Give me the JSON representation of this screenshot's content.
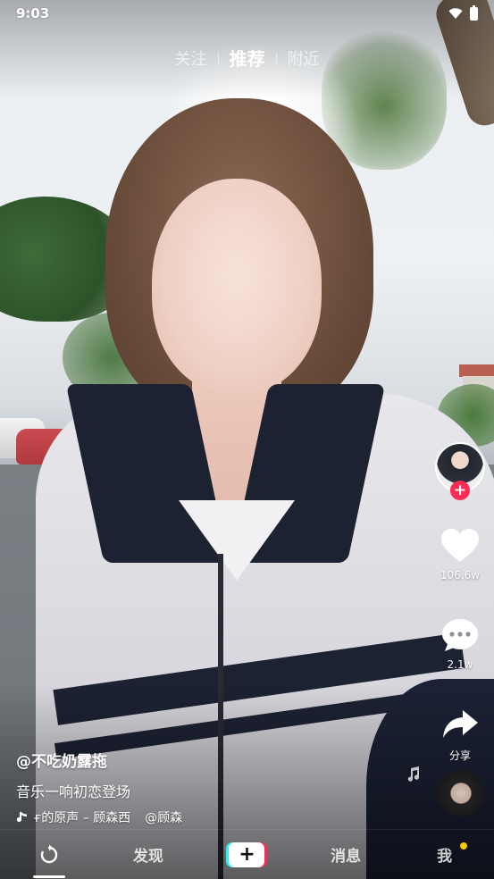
{
  "status_bar": {
    "time": "9:03",
    "icons": [
      "wifi-icon",
      "battery-icon"
    ]
  },
  "top_tabs": [
    {
      "label": "关注",
      "active": false
    },
    {
      "label": "推荐",
      "active": true
    },
    {
      "label": "附近",
      "active": false
    }
  ],
  "actions": {
    "avatar": "creator-avatar",
    "follow_icon": "+",
    "like": {
      "icon": "heart-icon",
      "count": "106.6w"
    },
    "comment": {
      "icon": "comment-icon",
      "count": "2.1w"
    },
    "share": {
      "icon": "share-icon",
      "label": "分享"
    }
  },
  "video_info": {
    "author": "@不吃奶露拖",
    "description": "音乐一响初恋登场",
    "music_track": "ғ的原声 – 顾森西",
    "music_author": "@顾森"
  },
  "bottom_nav": {
    "items": [
      {
        "id": "home",
        "label": "",
        "icon": "refresh-icon",
        "active": true
      },
      {
        "id": "discover",
        "label": "发现"
      },
      {
        "id": "create",
        "label": "+",
        "icon": "plus-icon"
      },
      {
        "id": "messages",
        "label": "消息"
      },
      {
        "id": "me",
        "label": "我",
        "badge": true
      }
    ]
  },
  "colors": {
    "accent_red": "#fe2c55",
    "accent_cyan": "#25f4ee",
    "badge_yellow": "#f5c800"
  }
}
